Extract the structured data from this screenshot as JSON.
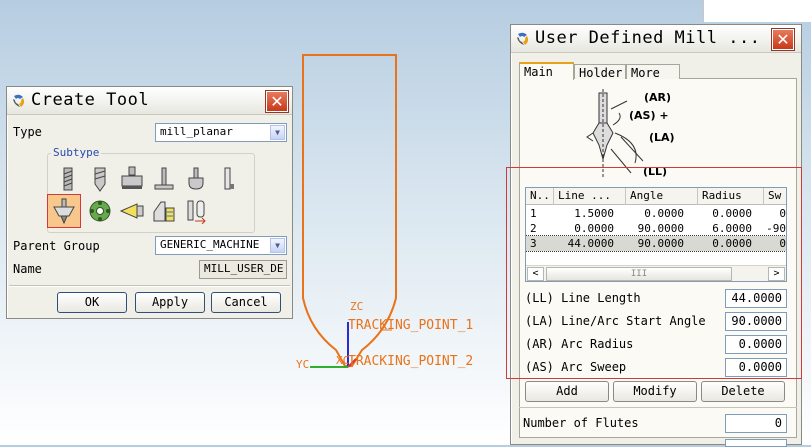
{
  "viewport": {
    "zc_label": "ZC",
    "yc_label": "YC",
    "xc_label": "XC",
    "tracking_point_1": "TRACKING_POINT_1",
    "tracking_point_2": "TRACKING_POINT_2"
  },
  "create_tool": {
    "title": "Create Tool",
    "type_label": "Type",
    "type_value": "mill_planar",
    "subtype_label": "Subtype",
    "subtype_icons": [
      "endmill-icon",
      "drill-mill-icon",
      "face-mill-icon",
      "t-cutter-icon",
      "ball-mill-icon",
      "barrel-icon",
      "user-defined-mill-icon",
      "thread-mill-icon",
      "chamfer-mill-icon",
      "holder-icon",
      "tool-change-icon"
    ],
    "parent_group_label": "Parent Group",
    "parent_group_value": "GENERIC_MACHINE",
    "name_label": "Name",
    "name_value": "MILL_USER_DE",
    "ok": "OK",
    "apply": "Apply",
    "cancel": "Cancel"
  },
  "udm": {
    "title": "User Defined Mill ...",
    "tabs": [
      "Main",
      "Holder",
      "More"
    ],
    "diagram_labels": {
      "ar": "(AR)",
      "as": "(AS) +",
      "la": "(LA)",
      "ll": "(LL)"
    },
    "columns": [
      "N..",
      "Line ...",
      "Angle",
      "Radius",
      "Sw"
    ],
    "rows": [
      [
        "1",
        "1.5000",
        "0.0000",
        "0.0000",
        "0"
      ],
      [
        "2",
        "0.0000",
        "90.0000",
        "6.0000",
        "-90"
      ],
      [
        "3",
        "44.0000",
        "90.0000",
        "0.0000",
        "0"
      ]
    ],
    "scroll_grip": "III",
    "params": [
      {
        "label": "(LL) Line Length",
        "value": "44.0000"
      },
      {
        "label": "(LA) Line/Arc Start Angle",
        "value": "90.0000"
      },
      {
        "label": "(AR) Arc Radius",
        "value": "0.0000"
      },
      {
        "label": "(AS) Arc Sweep",
        "value": "0.0000"
      }
    ],
    "add": "Add",
    "modify": "Modify",
    "delete": "Delete",
    "flutes_label": "Number of Flutes",
    "flutes_value": "0"
  },
  "colors": {
    "tool_outline": "#e8731a",
    "highlight_box": "#d23a3a",
    "axis_z": "#2b2bd6",
    "axis_y": "#2fae2f",
    "label_orange": "#e8731a"
  }
}
